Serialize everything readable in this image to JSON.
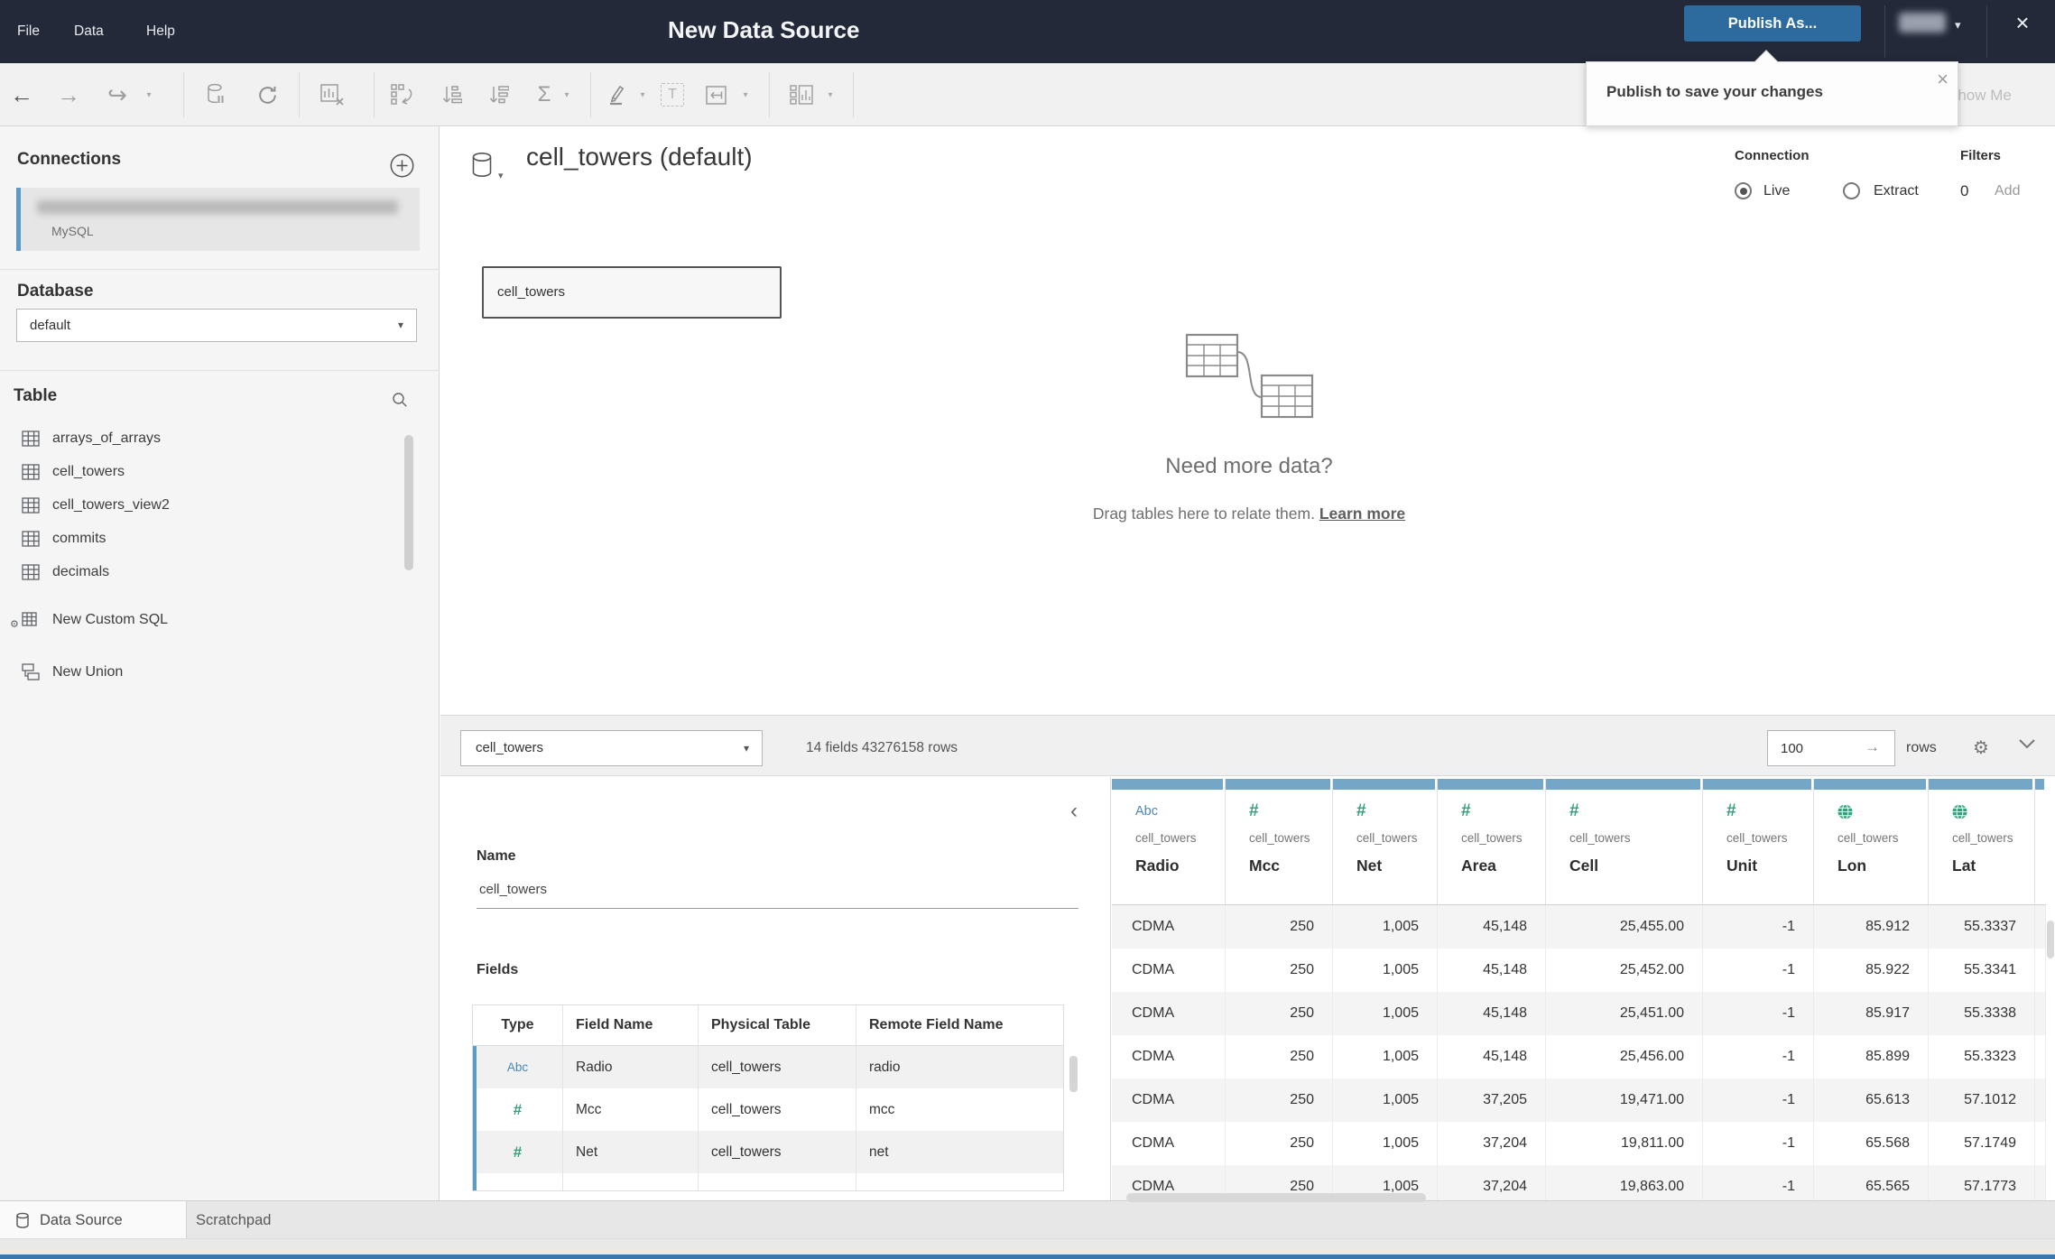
{
  "topbar": {
    "menus": [
      "File",
      "Data",
      "Help"
    ],
    "title": "New Data Source",
    "publish_button": "Publish As..."
  },
  "tooltip": {
    "text": "Publish to save your changes"
  },
  "toolbar": {
    "show_me": "Show Me"
  },
  "icons": {
    "back": "←",
    "forward": "→",
    "redo": "↪",
    "caret": "▾",
    "sigma": "Σ",
    "close": "×",
    "gear": "⚙",
    "arrow_right": "→",
    "collapse": "‹",
    "text_tool": "T"
  },
  "sidebar": {
    "connections_title": "Connections",
    "connection_subtitle": "MySQL",
    "database_label": "Database",
    "database_value": "default",
    "table_label": "Table",
    "tables": [
      "arrays_of_arrays",
      "cell_towers",
      "cell_towers_view2",
      "commits",
      "decimals"
    ],
    "new_custom_sql": "New Custom SQL",
    "new_union": "New Union"
  },
  "canvas": {
    "title": "cell_towers (default)",
    "table_box_label": "cell_towers",
    "connection_label": "Connection",
    "live_label": "Live",
    "extract_label": "Extract",
    "filters_label": "Filters",
    "filters_count": "0",
    "filters_add": "Add",
    "hint_title": "Need more data?",
    "hint_text": "Drag tables here to relate them. ",
    "hint_link": "Learn more"
  },
  "preview_bar": {
    "table_select": "cell_towers",
    "summary": "14 fields 43276158 rows",
    "row_count": "100",
    "rows_label": "rows"
  },
  "metadata": {
    "name_label": "Name",
    "name_value": "cell_towers",
    "fields_label": "Fields",
    "columns": [
      "Type",
      "Field Name",
      "Physical Table",
      "Remote Field Name"
    ],
    "fields": [
      {
        "type": "Abc",
        "name": "Radio",
        "table": "cell_towers",
        "remote": "radio"
      },
      {
        "type": "#",
        "name": "Mcc",
        "table": "cell_towers",
        "remote": "mcc"
      },
      {
        "type": "#",
        "name": "Net",
        "table": "cell_towers",
        "remote": "net"
      }
    ]
  },
  "grid": {
    "columns": [
      {
        "type": "Abc",
        "table": "cell_towers",
        "name": "Radio"
      },
      {
        "type": "#",
        "table": "cell_towers",
        "name": "Mcc"
      },
      {
        "type": "#",
        "table": "cell_towers",
        "name": "Net"
      },
      {
        "type": "#",
        "table": "cell_towers",
        "name": "Area"
      },
      {
        "type": "#",
        "table": "cell_towers",
        "name": "Cell"
      },
      {
        "type": "#",
        "table": "cell_towers",
        "name": "Unit"
      },
      {
        "type": "globe",
        "table": "cell_towers",
        "name": "Lon"
      },
      {
        "type": "globe",
        "table": "cell_towers",
        "name": "Lat"
      }
    ],
    "rows": [
      [
        "CDMA",
        "250",
        "1,005",
        "45,148",
        "25,455.00",
        "-1",
        "85.912",
        "55.3337"
      ],
      [
        "CDMA",
        "250",
        "1,005",
        "45,148",
        "25,452.00",
        "-1",
        "85.922",
        "55.3341"
      ],
      [
        "CDMA",
        "250",
        "1,005",
        "45,148",
        "25,451.00",
        "-1",
        "85.917",
        "55.3338"
      ],
      [
        "CDMA",
        "250",
        "1,005",
        "45,148",
        "25,456.00",
        "-1",
        "85.899",
        "55.3323"
      ],
      [
        "CDMA",
        "250",
        "1,005",
        "37,205",
        "19,471.00",
        "-1",
        "65.613",
        "57.1012"
      ],
      [
        "CDMA",
        "250",
        "1,005",
        "37,204",
        "19,811.00",
        "-1",
        "65.568",
        "57.1749"
      ],
      [
        "CDMA",
        "250",
        "1,005",
        "37,204",
        "19,863.00",
        "-1",
        "65.565",
        "57.1773"
      ]
    ]
  },
  "tabs": {
    "data_source": "Data Source",
    "scratchpad": "Scratchpad"
  }
}
